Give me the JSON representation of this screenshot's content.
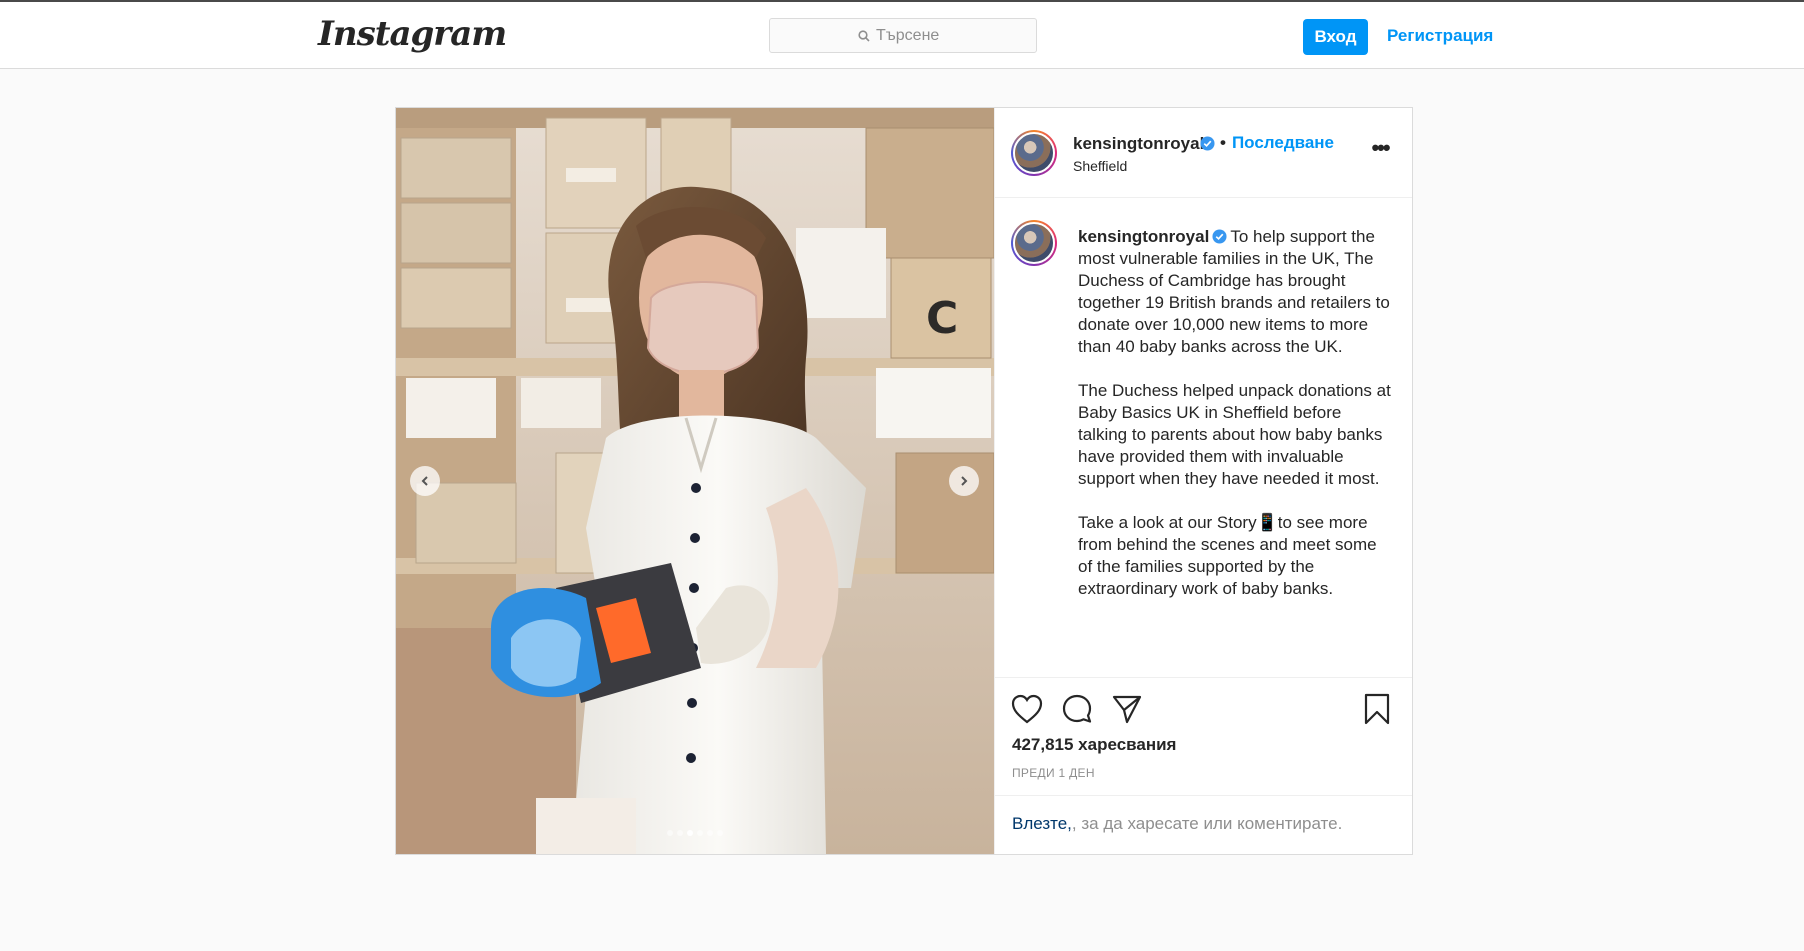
{
  "topbar": {
    "logo_text": "Instagram",
    "search_placeholder": "Търсене",
    "login_label": "Вход",
    "register_label": "Регистрация"
  },
  "post": {
    "username": "kensingtonroyal",
    "follow_label": "Последване",
    "bullet": "•",
    "location": "Sheffield",
    "more_label": "•••",
    "caption_paragraphs": [
      "To help support the most vulnerable families in the UK, The Duchess of Cambridge has brought together 19 British brands and retailers to donate over 10,000 new items to more than 40 baby banks across the UK.",
      "The Duchess helped unpack donations at Baby Basics UK in Sheffield before talking to parents about how baby banks have provided them with invaluable support when they have needed it most.",
      "Take a look at our Story📱to see more from behind the scenes and meet some of the families supported by the extraordinary work of baby banks."
    ],
    "likes_text": "427,815 харесвания",
    "timestamp": "ПРЕДИ 1 ДЕН",
    "login_prompt_link": "Влезте,",
    "login_prompt_rest": ", за да харесате или коментирате.",
    "carousel_dots": 6,
    "carousel_active_index": 2
  },
  "colors": {
    "accent": "#0095f6",
    "text": "#262626",
    "muted": "#8e8e8e",
    "background": "#fafafa",
    "border": "#dbdbdb"
  },
  "icons": {
    "search": "search-icon",
    "verified": "verified-badge-icon",
    "heart": "heart-icon",
    "comment": "comment-icon",
    "share": "share-icon",
    "save": "bookmark-icon",
    "prev": "chevron-left-icon",
    "next": "chevron-right-icon"
  }
}
